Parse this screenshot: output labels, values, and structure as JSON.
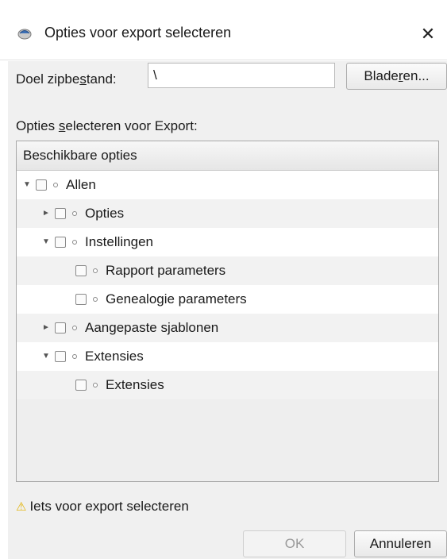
{
  "window": {
    "title": "Opties voor export selecteren",
    "close_icon": "✕"
  },
  "target": {
    "label_pre": "Doel zipbe",
    "label_mn": "s",
    "label_post": "tand:",
    "value": "\\",
    "browse_pre": "Blade",
    "browse_mn": "r",
    "browse_post": "en..."
  },
  "section": {
    "label_pre": "Opties ",
    "label_mn": "s",
    "label_post": "electeren voor Export:"
  },
  "tree": {
    "header": "Beschikbare opties",
    "items": [
      {
        "label": "Allen",
        "expander": "collapse"
      },
      {
        "label": "Opties",
        "expander": "expand"
      },
      {
        "label": "Instellingen",
        "expander": "collapse"
      },
      {
        "label": "Rapport parameters",
        "expander": "none"
      },
      {
        "label": "Genealogie parameters",
        "expander": "none"
      },
      {
        "label": "Aangepaste sjablonen",
        "expander": "expand"
      },
      {
        "label": "Extensies",
        "expander": "collapse"
      },
      {
        "label": "Extensies",
        "expander": "none"
      }
    ]
  },
  "status": {
    "warning_text": "Iets voor export selecteren"
  },
  "buttons": {
    "ok": "OK",
    "cancel": "Annuleren"
  }
}
